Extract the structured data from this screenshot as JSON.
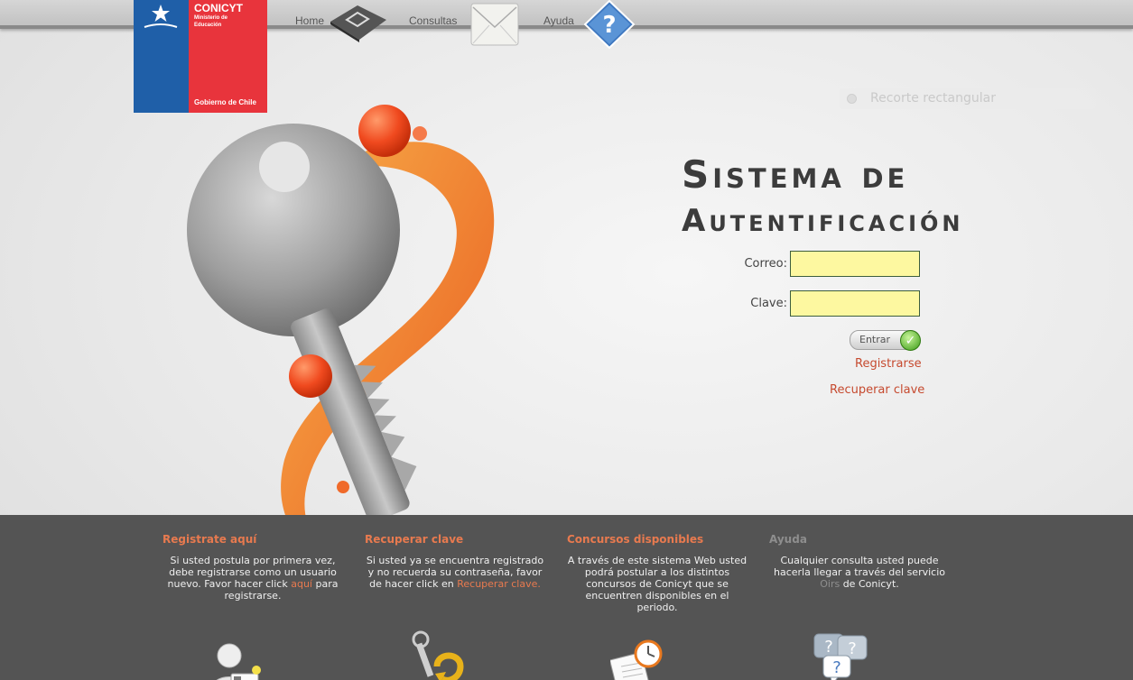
{
  "logo": {
    "brand": "CONICYT",
    "line1": "Ministerio de",
    "line2": "Educación",
    "footer": "Gobierno de Chile"
  },
  "nav": {
    "home": "Home",
    "consultas": "Consultas",
    "ayuda": "Ayuda"
  },
  "snip": "Recorte rectangular",
  "heading": {
    "line1": "Sistema de",
    "line2": "Autentificación"
  },
  "form": {
    "email_label": "Correo:",
    "email_value": "",
    "password_label": "Clave:",
    "password_value": "",
    "submit_label": "Entrar",
    "register_link": "Registrarse",
    "recover_link": "Recuperar clave"
  },
  "footer": {
    "col1": {
      "title": "Registrate aquí",
      "text_a": "Si usted postula por primera vez, debe registrarse como un usuario nuevo. Favor hacer click ",
      "link": "aquí",
      "text_b": " para registrarse."
    },
    "col2": {
      "title": "Recuperar clave",
      "text_a": "Si usted ya se encuentra registrado y no recuerda su contraseña, favor de hacer click en ",
      "link": "Recuperar clave."
    },
    "col3": {
      "title": "Concursos disponibles",
      "text_a": "A través de este sistema Web usted podrá postular a los distintos concursos de Conicyt que se encuentren disponibles en el periodo."
    },
    "col4": {
      "title": "Ayuda",
      "text_a": "Cualquier consulta usted puede hacerla llegar a través del servicio ",
      "link": "Oirs",
      "text_b": " de Conicyt."
    }
  },
  "colors": {
    "accent": "#c64a2f",
    "footer_bg": "#545454",
    "input_bg": "#fdf8a0"
  }
}
